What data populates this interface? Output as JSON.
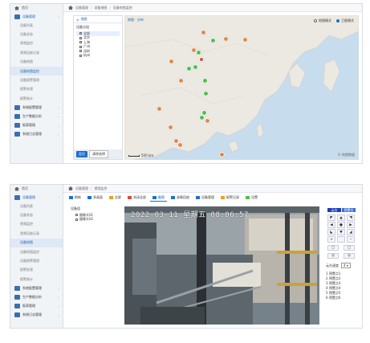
{
  "colors": {
    "primary": "#1a6fd1",
    "sidebar_bg": "#f1f4f7",
    "map_water": "#c7dcec",
    "map_land": "#ece9e2",
    "pin_offline": "#e1894a",
    "pin_online": "#4fbf4f",
    "pin_alarm": "#d64b3a"
  },
  "panel_top": {
    "sidebar": {
      "home": "首页",
      "items": [
        {
          "label": "设备管理",
          "icon": "monitor-icon",
          "type": "main"
        },
        {
          "label": "设备列表",
          "type": "sub"
        },
        {
          "label": "设备状态",
          "type": "sub"
        },
        {
          "label": "视频监控",
          "type": "sub"
        },
        {
          "label": "视频回放记录",
          "type": "sub"
        },
        {
          "label": "设备地图",
          "type": "sub"
        },
        {
          "label": "设备地图监控",
          "type": "sub",
          "active": true
        },
        {
          "label": "设备报警管理",
          "type": "sub"
        },
        {
          "label": "报警处理",
          "type": "sub"
        },
        {
          "label": "报警统计",
          "type": "sub"
        },
        {
          "label": "系统配置管理",
          "icon": "gear-icon",
          "type": "bottom"
        },
        {
          "label": "生产数据分析",
          "icon": "chart-icon",
          "type": "bottom"
        },
        {
          "label": "报表管理",
          "icon": "file-icon",
          "type": "bottom"
        },
        {
          "label": "系统日志管理",
          "icon": "log-icon",
          "type": "bottom"
        }
      ]
    },
    "breadcrumb": [
      "设备管理",
      "设备地图",
      "设备地图监控"
    ],
    "tree": {
      "header": "地图",
      "root": "设备分组",
      "nodes": [
        "全部",
        "北京",
        "上海",
        "广州",
        "深圳",
        "杭州"
      ],
      "buttons": [
        "定位",
        "清除选择"
      ]
    },
    "map": {
      "header": "地图 · 分布",
      "tool_1": "地图模式",
      "tool_2": "卫星模式",
      "scale": "500 km",
      "credit": "© 地图数据"
    }
  },
  "panel_bottom": {
    "sidebar": {
      "home": "首页",
      "items": [
        {
          "label": "设备管理",
          "icon": "monitor-icon",
          "type": "main"
        },
        {
          "label": "设备列表",
          "type": "sub"
        },
        {
          "label": "设备状态",
          "type": "sub"
        },
        {
          "label": "视频监控",
          "type": "sub"
        },
        {
          "label": "视频回放记录",
          "type": "sub"
        },
        {
          "label": "设备地图",
          "type": "sub",
          "active": true
        },
        {
          "label": "设备地图监控",
          "type": "sub"
        },
        {
          "label": "设备报警管理",
          "type": "sub"
        },
        {
          "label": "报警处理",
          "type": "sub"
        },
        {
          "label": "报警统计",
          "type": "sub"
        },
        {
          "label": "系统配置管理",
          "icon": "gear-icon",
          "type": "bottom"
        },
        {
          "label": "生产数据分析",
          "icon": "chart-icon",
          "type": "bottom"
        },
        {
          "label": "报表管理",
          "icon": "file-icon",
          "type": "bottom"
        },
        {
          "label": "系统日志管理",
          "icon": "log-icon",
          "type": "bottom"
        }
      ]
    },
    "breadcrumb": [
      "设备管理",
      "视频监控"
    ],
    "tabs": [
      {
        "label": "刷新",
        "color": "#1a6fd1"
      },
      {
        "label": "多画面",
        "color": "#1a6fd1"
      },
      {
        "label": "全屏",
        "color": "#f0a020"
      },
      {
        "label": "关闭全部",
        "color": "#d64b3a"
      },
      {
        "label": "截图",
        "color": "#1a6fd1",
        "active": true
      },
      {
        "label": "录像回放",
        "color": "#1a6fd1"
      },
      {
        "label": "设备管理",
        "color": "#1a6fd1"
      },
      {
        "label": "报警记录",
        "color": "#f0a020"
      },
      {
        "label": "设置",
        "color": "#4fbf4f"
      }
    ],
    "tree": {
      "root": "设备组",
      "nodes": [
        "摄像头01",
        "摄像头02"
      ]
    },
    "video": {
      "osd": "2022-03-11 星期五 08:06:57"
    },
    "ptz": {
      "tab_1": "云台",
      "tab_2": "预置位",
      "grid": [
        "◤",
        "▲",
        "◥",
        "◀",
        "●",
        "▶",
        "◣",
        "▼",
        "◢",
        "+",
        "",
        "−"
      ],
      "row_1": [
        "□",
        "□"
      ],
      "row_2": [
        "◎",
        "◎"
      ],
      "speed_label": "云台速度",
      "speed_value": "4",
      "presets": [
        "1 预置点1",
        "2 预置点2",
        "3 预置点3",
        "4 预置点4",
        "5 预置点5",
        "6 预置点6"
      ]
    }
  }
}
